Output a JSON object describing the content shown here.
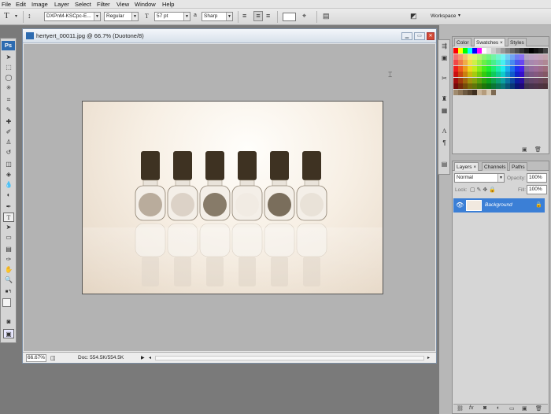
{
  "menu": [
    "File",
    "Edit",
    "Image",
    "Layer",
    "Select",
    "Filter",
    "View",
    "Window",
    "Help"
  ],
  "options_bar": {
    "font_family": "DXPnM-KSCpc-E...",
    "font_style": "Regular",
    "font_size": "57 pt",
    "aa_icon_label": "a",
    "antialias": "Sharp",
    "workspace": "Workspace"
  },
  "document": {
    "title": "hertyert_00011.jpg @ 66.7% (Duotone/8)",
    "zoom": "66.67%",
    "doc_size": "Doc: 554.5K/554.5K"
  },
  "swatches_panel": {
    "tabs": [
      "Color",
      "Swatches",
      "Styles"
    ],
    "active_tab": "Swatches"
  },
  "layers_panel": {
    "tabs": [
      "Layers",
      "Channels",
      "Paths"
    ],
    "active_tab": "Layers",
    "blend_mode": "Normal",
    "opacity_label": "Opacity:",
    "opacity": "100%",
    "lock_label": "Lock:",
    "fill_label": "Fill:",
    "fill": "100%",
    "layers": [
      {
        "name": "Background",
        "selected": true
      }
    ]
  },
  "colors": {
    "accent_blue": "#3b7fd6",
    "ps_logo_blue": "#2d6bb0",
    "bottle_cap": "#3e3222"
  },
  "bottles": [
    {
      "liquid": "#b9ac9c"
    },
    {
      "liquid": "#dcd2c7"
    },
    {
      "liquid": "#877b69"
    },
    {
      "liquid": "#f1ebe3"
    },
    {
      "liquid": "#7a6e5c"
    },
    {
      "liquid": "#e9e2d8"
    }
  ]
}
